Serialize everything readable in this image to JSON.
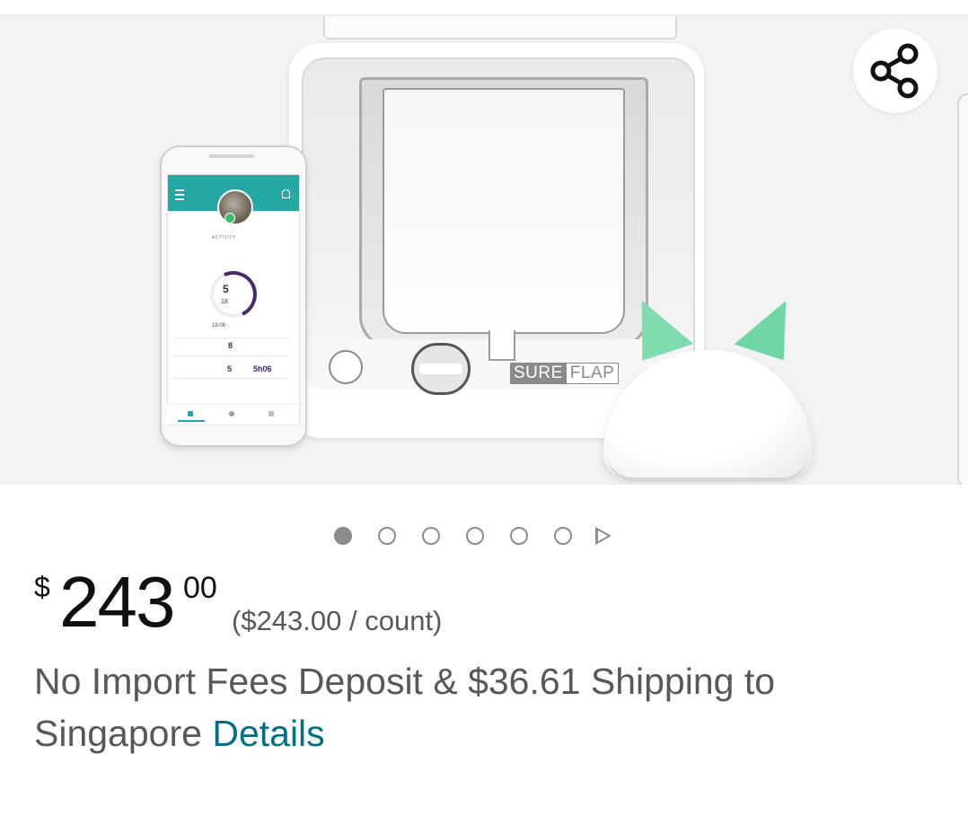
{
  "product": {
    "image_brand": {
      "sure": "SURE",
      "flap": "FLAP"
    },
    "carousel": {
      "total_dots": 6,
      "active_index": 0
    }
  },
  "price": {
    "symbol": "$",
    "whole": "243",
    "fraction": "00",
    "unit_price": "($243.00 / count)"
  },
  "shipping": {
    "text": "No Import Fees Deposit & $36.61 Shipping to Singapore",
    "details_link": "Details"
  },
  "phone_screen": {
    "activity_label": "ACTIVITY",
    "ring_value": "5",
    "ring_sub": "18",
    "last_entered_time": "18:06",
    "today_count": "8",
    "avg_count": "5",
    "avg_time": "5h06"
  },
  "colors": {
    "price_text": "#0f1111",
    "secondary_text": "#565959",
    "link": "#007185",
    "app_teal": "#25a7a5",
    "ear_green": "#7fdcae"
  },
  "icons": {
    "share": "share-icon",
    "next": "play-triangle-icon"
  }
}
